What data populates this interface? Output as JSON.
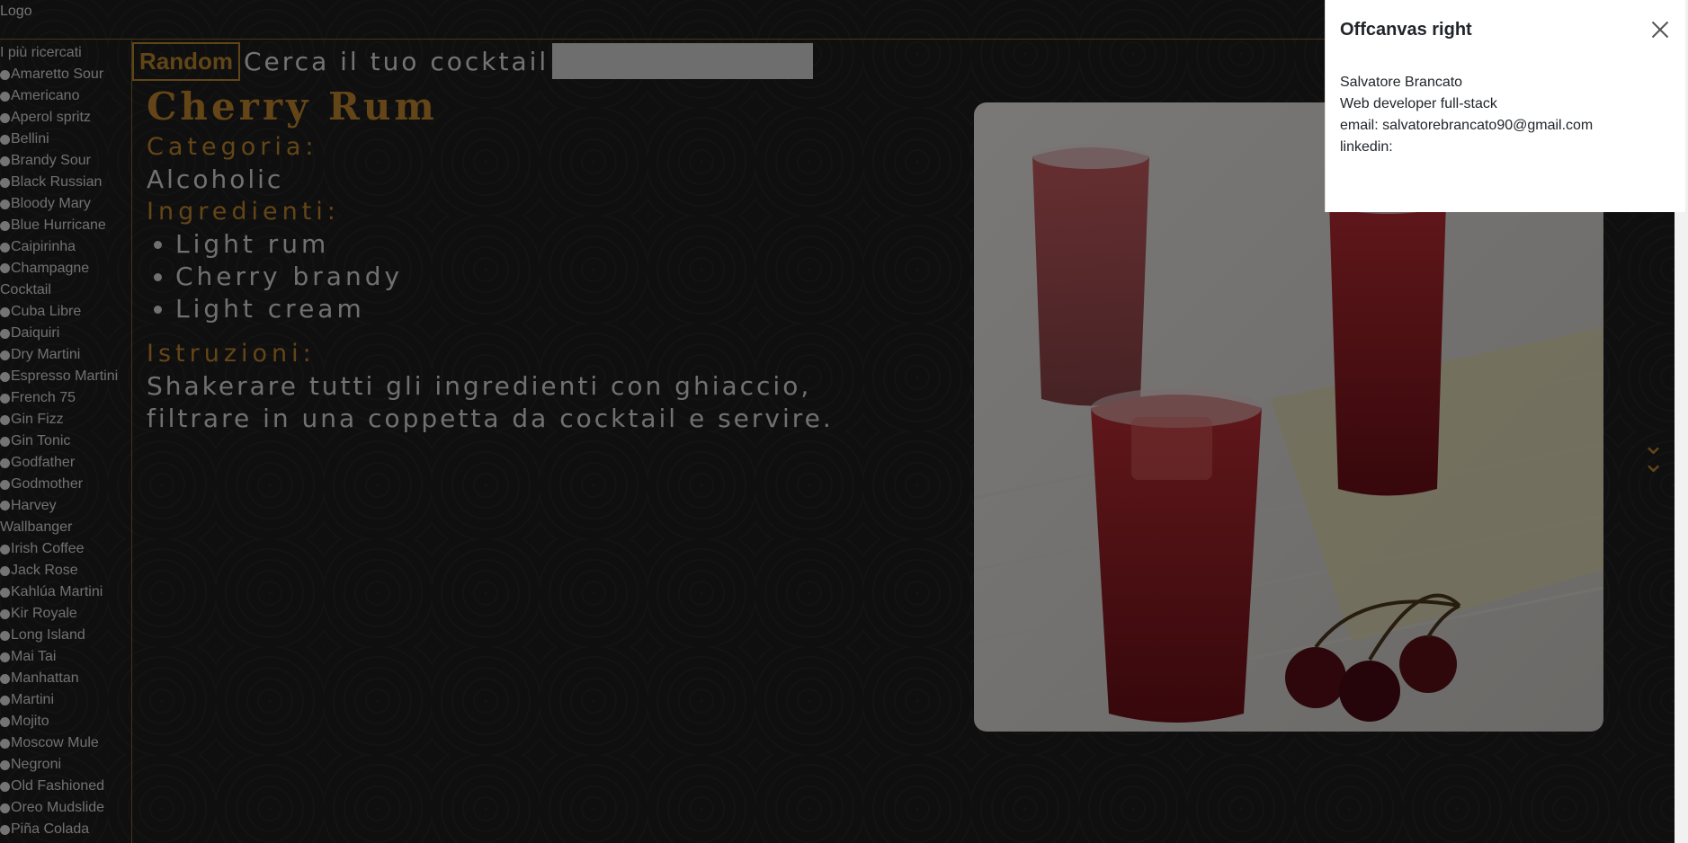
{
  "header": {
    "logo": "Logo"
  },
  "sidebar": {
    "title": "I più ricercati",
    "items": [
      "Amaretto Sour",
      "Americano",
      "Aperol spritz",
      "Bellini",
      "Brandy Sour",
      "Black Russian",
      "Bloody Mary",
      "Blue Hurricane",
      "Caipirinha",
      "Champagne Cocktail",
      "Cuba Libre",
      "Daiquiri",
      "Dry Martini",
      "Espresso Martini",
      "French 75",
      "Gin Fizz",
      "Gin Tonic",
      "Godfather",
      "Godmother",
      "Harvey Wallbanger",
      "Irish Coffee",
      "Jack Rose",
      "Kahlúa Martini",
      "Kir Royale",
      "Long Island",
      "Mai Tai",
      "Manhattan",
      "Martini",
      "Mojito",
      "Moscow Mule",
      "Negroni",
      "Old Fashioned",
      "Oreo Mudslide",
      "Piña Colada"
    ]
  },
  "search": {
    "random_label": "Random",
    "label": "Cerca il tuo cocktail",
    "placeholder": ""
  },
  "cocktail": {
    "name": "Cherry Rum",
    "category_label": "Categoria:",
    "category": "Alcoholic",
    "ingredients_label": "Ingredienti:",
    "ingredients": [
      "Light rum",
      "Cherry brandy",
      "Light cream"
    ],
    "instructions_label": "Istruzioni:",
    "instructions": "Shakerare tutti gli ingredienti con ghiaccio, filtrare in una coppetta da cocktail e servire."
  },
  "icons": {
    "scroll": "chevron-double-down-icon",
    "close": "close-icon"
  },
  "offcanvas": {
    "title": "Offcanvas right",
    "lines": [
      "Salvatore Brancato",
      "Web developer full-stack",
      "email: salvatorebrancato90@gmail.com",
      "linkedin:"
    ]
  },
  "colors": {
    "accent": "#c88b2f",
    "background": "#1e1e1e",
    "panel": "#ffffff"
  }
}
